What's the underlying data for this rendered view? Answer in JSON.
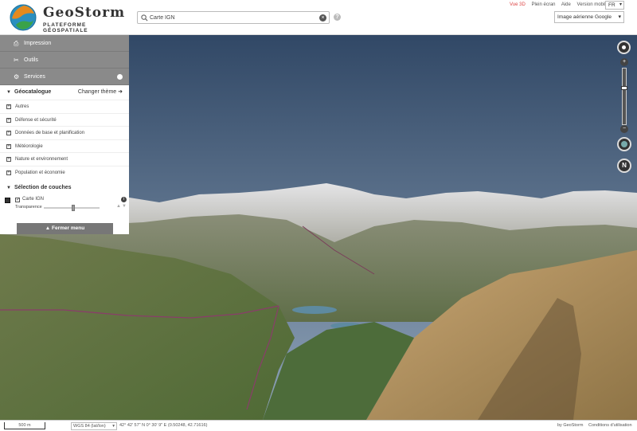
{
  "header": {
    "logo_name": "GeoStorm",
    "logo_tagline": "PLATEFORME GÉOSPATIALE",
    "search_value": "Carte IGN",
    "top_links": [
      "Vue 3D",
      "Plein écran",
      "Aide",
      "Version mobile"
    ],
    "language": "FR",
    "basemap": "Image aérienne Google"
  },
  "sidebar": {
    "buttons": [
      {
        "label": "Impression",
        "icon": "print-icon"
      },
      {
        "label": "Outils",
        "icon": "tools-icon"
      },
      {
        "label": "Services",
        "icon": "gears-icon"
      }
    ],
    "geocatalogue_title": "Géocatalogue",
    "change_theme": "Changer thème",
    "categories": [
      "Autres",
      "Défense et sécurité",
      "Données de base et planification",
      "Météorologie",
      "Nature et environnement",
      "Population et économie"
    ],
    "layers_title": "Sélection de couches",
    "layer_name": "Carte IGN",
    "transparency_label": "Transparence",
    "transparency_value": 0.5,
    "close_menu": "Fermer menu"
  },
  "footer": {
    "scale": "500 m",
    "crs": "WGS 84 (lat/lon)",
    "coords": "42° 42' 57\" N 0° 30' 9\" E (0.50248, 42.71616)",
    "credit": "by GeoStorm",
    "terms": "Conditions d'utilisation"
  },
  "colors": {
    "sidebar_button": "#8a8a8a",
    "sky_top": "#314866",
    "sky_bottom": "#8fa3b8",
    "link_red": "#dd4444"
  }
}
